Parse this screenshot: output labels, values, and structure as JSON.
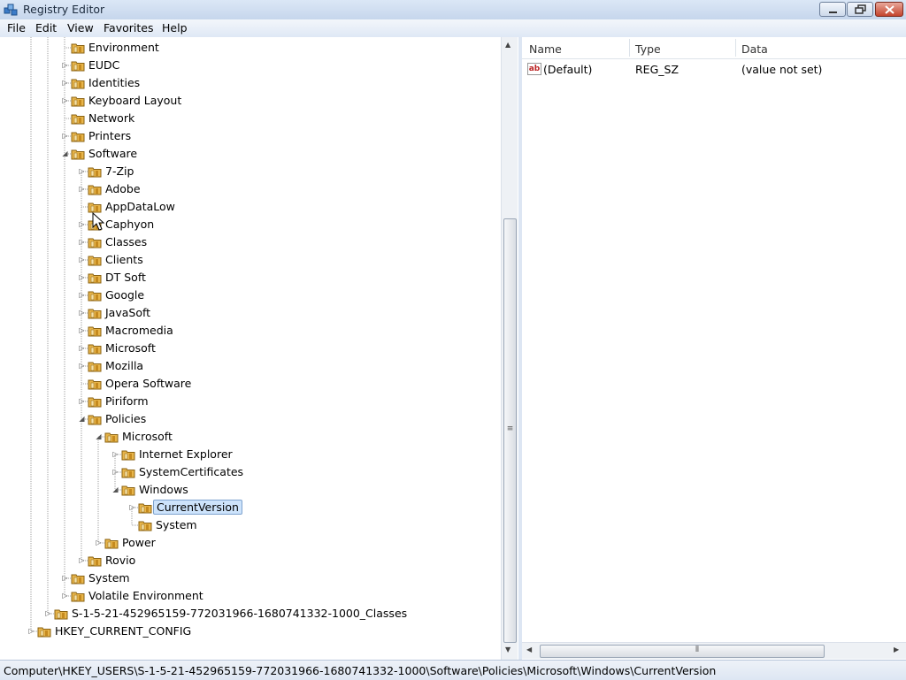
{
  "window": {
    "title": "Registry Editor"
  },
  "menu": [
    "File",
    "Edit",
    "View",
    "Favorites",
    "Help"
  ],
  "tree": [
    {
      "label": "Environment",
      "level": 2,
      "expander": "none"
    },
    {
      "label": "EUDC",
      "level": 2,
      "expander": "collapsed"
    },
    {
      "label": "Identities",
      "level": 2,
      "expander": "collapsed"
    },
    {
      "label": "Keyboard Layout",
      "level": 2,
      "expander": "collapsed"
    },
    {
      "label": "Network",
      "level": 2,
      "expander": "none"
    },
    {
      "label": "Printers",
      "level": 2,
      "expander": "collapsed"
    },
    {
      "label": "Software",
      "level": 2,
      "expander": "expanded"
    },
    {
      "label": "7-Zip",
      "level": 3,
      "expander": "collapsed"
    },
    {
      "label": "Adobe",
      "level": 3,
      "expander": "collapsed"
    },
    {
      "label": "AppDataLow",
      "level": 3,
      "expander": "none"
    },
    {
      "label": "Caphyon",
      "level": 3,
      "expander": "collapsed"
    },
    {
      "label": "Classes",
      "level": 3,
      "expander": "collapsed"
    },
    {
      "label": "Clients",
      "level": 3,
      "expander": "collapsed"
    },
    {
      "label": "DT Soft",
      "level": 3,
      "expander": "collapsed"
    },
    {
      "label": "Google",
      "level": 3,
      "expander": "collapsed"
    },
    {
      "label": "JavaSoft",
      "level": 3,
      "expander": "collapsed"
    },
    {
      "label": "Macromedia",
      "level": 3,
      "expander": "collapsed"
    },
    {
      "label": "Microsoft",
      "level": 3,
      "expander": "collapsed"
    },
    {
      "label": "Mozilla",
      "level": 3,
      "expander": "collapsed"
    },
    {
      "label": "Opera Software",
      "level": 3,
      "expander": "none"
    },
    {
      "label": "Piriform",
      "level": 3,
      "expander": "collapsed"
    },
    {
      "label": "Policies",
      "level": 3,
      "expander": "expanded"
    },
    {
      "label": "Microsoft",
      "level": 4,
      "expander": "expanded"
    },
    {
      "label": "Internet Explorer",
      "level": 5,
      "expander": "collapsed"
    },
    {
      "label": "SystemCertificates",
      "level": 5,
      "expander": "collapsed"
    },
    {
      "label": "Windows",
      "level": 5,
      "expander": "expanded"
    },
    {
      "label": "CurrentVersion",
      "level": 6,
      "expander": "collapsed",
      "selected": true
    },
    {
      "label": "System",
      "level": 6,
      "expander": "none"
    },
    {
      "label": "Power",
      "level": 4,
      "expander": "collapsed"
    },
    {
      "label": "Rovio",
      "level": 3,
      "expander": "collapsed"
    },
    {
      "label": "System",
      "level": 2,
      "expander": "collapsed"
    },
    {
      "label": "Volatile Environment",
      "level": 2,
      "expander": "collapsed"
    },
    {
      "label": "S-1-5-21-452965159-772031966-1680741332-1000_Classes",
      "level": 1,
      "expander": "collapsed"
    },
    {
      "label": "HKEY_CURRENT_CONFIG",
      "level": 0,
      "expander": "collapsed"
    }
  ],
  "columns": {
    "name": "Name",
    "type": "Type",
    "data": "Data"
  },
  "values": [
    {
      "name": "(Default)",
      "type": "REG_SZ",
      "data": "(value not set)",
      "icon": "string-value-icon"
    }
  ],
  "status": "Computer\\HKEY_USERS\\S-1-5-21-452965159-772031966-1680741332-1000\\Software\\Policies\\Microsoft\\Windows\\CurrentVersion",
  "colors": {
    "selection": "#cde3fb",
    "folder": "#e8b54a",
    "titlebar": "#c6d6ec"
  }
}
